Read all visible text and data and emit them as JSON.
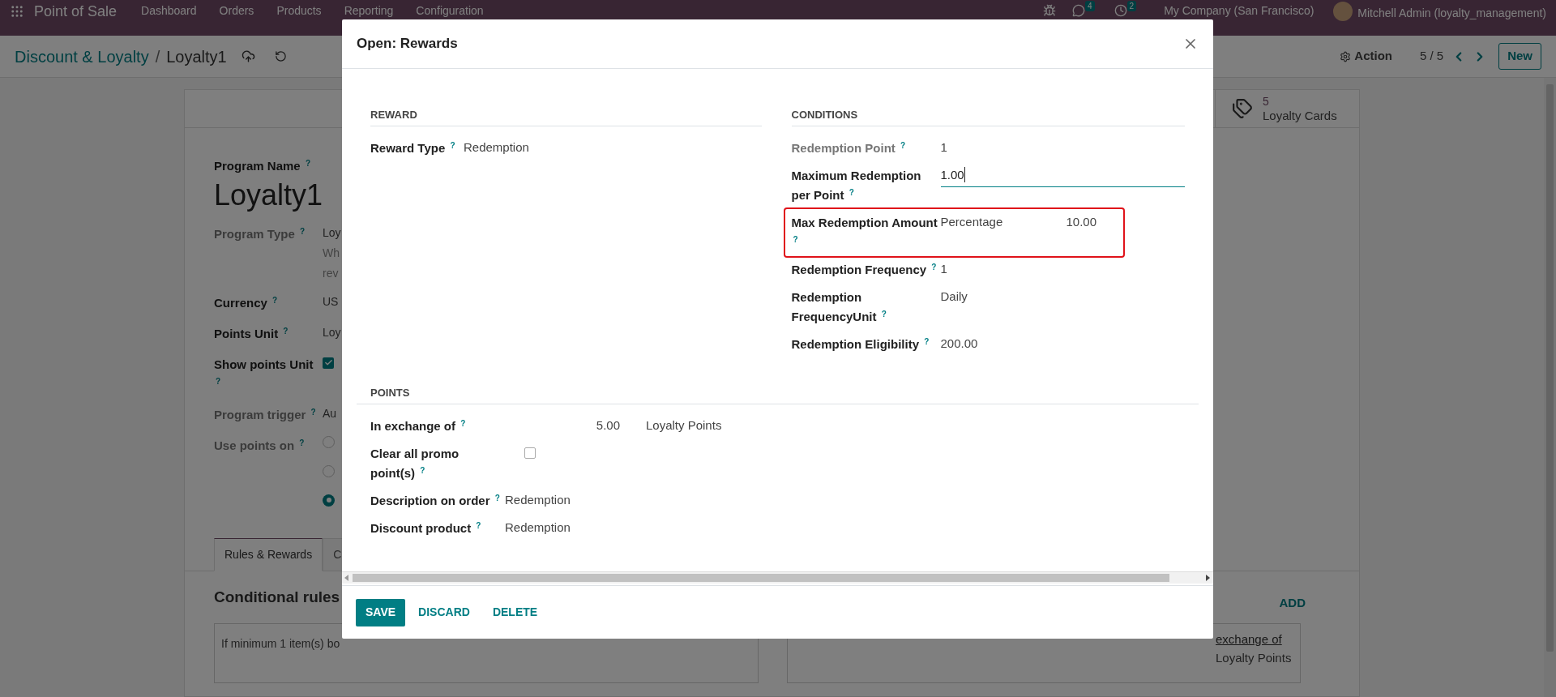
{
  "navbar": {
    "app_name": "Point of Sale",
    "menu": [
      "Dashboard",
      "Orders",
      "Products",
      "Reporting",
      "Configuration"
    ],
    "messages_count": "4",
    "activities_count": "2",
    "company": "My Company (San Francisco)",
    "user": "Mitchell Admin (loyalty_management)"
  },
  "breadcrumb": {
    "parent": "Discount & Loyalty",
    "separator": "/",
    "current": "Loyalty1"
  },
  "control_panel": {
    "action": "Action",
    "pager": "5 / 5",
    "new_button": "New"
  },
  "form": {
    "smart_button": {
      "count": "5",
      "label": "Loyalty Cards"
    },
    "name_label": "Program Name $^{?}$",
    "name": "Loyalty1",
    "fields": [
      {
        "label": "Program Type $^{?}$",
        "required": false,
        "kind": "text",
        "value": "Loy",
        "notes": [
          "Wh",
          "rev"
        ]
      },
      {
        "label": "Currency $^{?}$",
        "required": true,
        "kind": "text",
        "value": "US"
      },
      {
        "label": "Points Unit $^{?}$",
        "required": true,
        "kind": "text",
        "value": "Loy"
      },
      {
        "label": "Show points Unit $^{?}$",
        "required": true,
        "kind": "checkbox",
        "checked": true
      },
      {
        "label": "Program trigger $^{?}$",
        "required": false,
        "kind": "text",
        "value": "Au"
      },
      {
        "label": "Use points on $^{?}$",
        "required": false,
        "kind": "radio",
        "options": [
          {
            "selected": false
          },
          {
            "selected": false
          },
          {
            "selected": true
          }
        ]
      }
    ],
    "tabs": [
      {
        "label": "Rules & Rewards",
        "selected": true
      },
      {
        "label": "C",
        "selected": false
      }
    ],
    "rules_title": "Conditional rules",
    "rule_card": "If minimum 1 item(s) bo",
    "add_link": "ADD",
    "reward_card": {
      "link": "exchange of",
      "text": "Loyalty Points"
    }
  },
  "dialog": {
    "title": "Open: Rewards",
    "reward": {
      "heading": "REWARD",
      "fields": [
        {
          "label": "Reward Type $^{?}$",
          "required": true,
          "kind": "text",
          "values": [
            "Redemption"
          ],
          "highlighted": false
        }
      ]
    },
    "conditions": {
      "heading": "CONDITIONS",
      "fields": [
        {
          "label": "Redemption Point $^{?}$",
          "required": false,
          "kind": "text",
          "values": [
            "1"
          ],
          "highlighted": false
        },
        {
          "label": "Maximum Redemption per Point $^{?}$",
          "required": true,
          "kind": "input",
          "values": [
            "1.00"
          ],
          "highlighted": false
        },
        {
          "label": "Max Redemption Amount $^{?}$",
          "required": true,
          "kind": "text",
          "values": [
            "Percentage",
            "10.00"
          ],
          "highlighted": true
        },
        {
          "label": "Redemption Frequency $^{?}$",
          "required": true,
          "kind": "text",
          "values": [
            "1"
          ],
          "highlighted": false
        },
        {
          "label": "Redemption FrequencyUnit $^{?}$",
          "required": true,
          "kind": "text",
          "values": [
            "Daily"
          ],
          "highlighted": false
        },
        {
          "label": "Redemption Eligibility $^{?}$",
          "required": true,
          "kind": "text",
          "values": [
            "200.00"
          ],
          "highlighted": false
        }
      ]
    },
    "points": {
      "heading": "POINTS",
      "fields": [
        {
          "label": "In exchange of $^{?}$",
          "required": true,
          "kind": "amount",
          "values": [
            "5.00",
            "Loyalty Points"
          ]
        },
        {
          "label": "Clear all promo point(s) $^{?}$",
          "required": true,
          "kind": "checkbox",
          "checked": false
        },
        {
          "label": "Description on order $^{?}$",
          "required": true,
          "kind": "text",
          "values": [
            "Redemption"
          ]
        },
        {
          "label": "Discount product $^{?}$",
          "required": true,
          "kind": "text",
          "values": [
            "Redemption"
          ]
        }
      ]
    },
    "buttons": [
      {
        "label": "SAVE",
        "kind": "primary"
      },
      {
        "label": "DISCARD",
        "kind": "link"
      },
      {
        "label": "DELETE",
        "kind": "link"
      }
    ]
  }
}
